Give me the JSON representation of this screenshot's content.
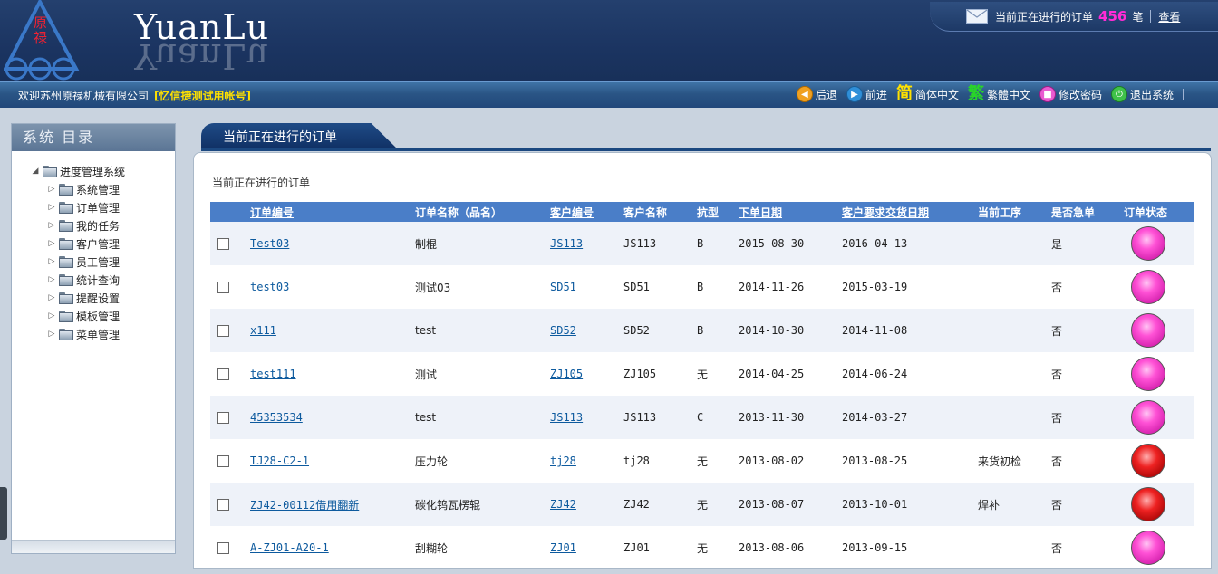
{
  "header": {
    "brand": "YuanLu",
    "logo_text": "原禄",
    "notification": {
      "prefix": "当前正在进行的订单",
      "count": "456",
      "unit": "笔",
      "view_link": "查看"
    }
  },
  "navbar": {
    "welcome": "欢迎苏州原禄机械有限公司",
    "account": "[忆信捷测试用帐号]",
    "links": [
      {
        "label": "后退",
        "icon": "back-arrow-icon"
      },
      {
        "label": "前进",
        "icon": "forward-arrow-icon"
      },
      {
        "label": "简体中文",
        "glyph": "简",
        "icon": "simplified-chinese-icon"
      },
      {
        "label": "繁體中文",
        "glyph": "繁",
        "icon": "traditional-chinese-icon"
      },
      {
        "label": "修改密码",
        "icon": "lock-icon"
      },
      {
        "label": "退出系统",
        "icon": "exit-icon"
      }
    ]
  },
  "sidebar": {
    "title": "系统 目录",
    "root": "进度管理系统",
    "items": [
      "系统管理",
      "订单管理",
      "我的任务",
      "客户管理",
      "员工管理",
      "统计查询",
      "提醒设置",
      "模板管理",
      "菜单管理"
    ]
  },
  "main": {
    "tab": "当前正在进行的订单",
    "panel_title": "当前正在进行的订单",
    "columns": [
      "订单编号",
      "订单名称（品名）",
      "客户编号",
      "客户名称",
      "抗型",
      "下单日期",
      "客户要求交货日期",
      "当前工序",
      "是否急单",
      "订单状态"
    ],
    "rows": [
      {
        "order_no": "Test03",
        "name": "制棍",
        "cust_no": "JS113",
        "cust_name": "JS113",
        "type": "B",
        "order_date": "2015-08-30",
        "due_date": "2016-04-13",
        "process": "",
        "urgent": "是",
        "status": "pink"
      },
      {
        "order_no": "test03",
        "name": "测试03",
        "cust_no": "SD51",
        "cust_name": "SD51",
        "type": "B",
        "order_date": "2014-11-26",
        "due_date": "2015-03-19",
        "process": "",
        "urgent": "否",
        "status": "pink"
      },
      {
        "order_no": "x111",
        "name": "test",
        "cust_no": "SD52",
        "cust_name": "SD52",
        "type": "B",
        "order_date": "2014-10-30",
        "due_date": "2014-11-08",
        "process": "",
        "urgent": "否",
        "status": "pink"
      },
      {
        "order_no": "test111",
        "name": "测试",
        "cust_no": "ZJ105",
        "cust_name": "ZJ105",
        "type": "无",
        "order_date": "2014-04-25",
        "due_date": "2014-06-24",
        "process": "",
        "urgent": "否",
        "status": "pink"
      },
      {
        "order_no": "45353534",
        "name": "test",
        "cust_no": "JS113",
        "cust_name": "JS113",
        "type": "C",
        "order_date": "2013-11-30",
        "due_date": "2014-03-27",
        "process": "",
        "urgent": "否",
        "status": "pink"
      },
      {
        "order_no": "TJ28-C2-1",
        "name": "压力轮",
        "cust_no": "tj28",
        "cust_name": "tj28",
        "type": "无",
        "order_date": "2013-08-02",
        "due_date": "2013-08-25",
        "process": "来货初检",
        "urgent": "否",
        "status": "red"
      },
      {
        "order_no": "ZJ42-00112借用翻新",
        "name": "碳化钨瓦楞辊",
        "cust_no": "ZJ42",
        "cust_name": "ZJ42",
        "type": "无",
        "order_date": "2013-08-07",
        "due_date": "2013-10-01",
        "process": "焊补",
        "urgent": "否",
        "status": "red"
      },
      {
        "order_no": "A-ZJ01-A20-1",
        "name": "刮糊轮",
        "cust_no": "ZJ01",
        "cust_name": "ZJ01",
        "type": "无",
        "order_date": "2013-08-06",
        "due_date": "2013-09-15",
        "process": "",
        "urgent": "否",
        "status": "pink"
      }
    ]
  },
  "colors": {
    "header_bg": "#1b3461",
    "table_header": "#4a7ec8",
    "status_pink": "#ff52d6",
    "status_red": "#ee2222",
    "account_yellow": "#ffe100",
    "count_magenta": "#ff2bd6"
  }
}
